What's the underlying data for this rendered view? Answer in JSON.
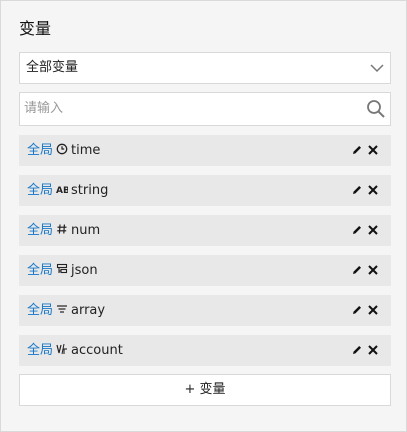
{
  "panel": {
    "title": "变量"
  },
  "filter": {
    "selected": "全部变量"
  },
  "search": {
    "placeholder": "请输入",
    "value": ""
  },
  "variables": [
    {
      "scope": "全局",
      "type_icon": "clock-icon",
      "name": "time"
    },
    {
      "scope": "全局",
      "type_icon": "ab-text-icon",
      "name": "string"
    },
    {
      "scope": "全局",
      "type_icon": "hash-icon",
      "name": "num"
    },
    {
      "scope": "全局",
      "type_icon": "json-icon",
      "name": "json"
    },
    {
      "scope": "全局",
      "type_icon": "list-icon",
      "name": "array"
    },
    {
      "scope": "全局",
      "type_icon": "account-icon",
      "name": "account"
    }
  ],
  "add_button": {
    "label": "+ 变量"
  },
  "colors": {
    "scope_blue": "#1677c8",
    "row_bg": "#e8e8e8",
    "panel_bg": "#f5f5f5"
  }
}
